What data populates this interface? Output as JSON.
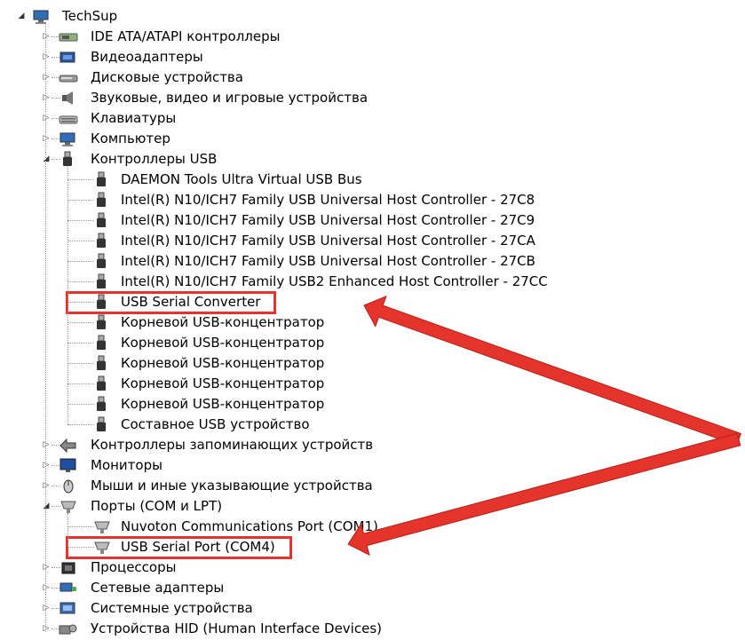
{
  "root": {
    "label": "TechSup",
    "icon": "computer-icon"
  },
  "categories": [
    {
      "label": "IDE ATA/ATAPI контроллеры",
      "icon": "ide-controller-icon",
      "expanded": false
    },
    {
      "label": "Видеоадаптеры",
      "icon": "display-adapter-icon",
      "expanded": false
    },
    {
      "label": "Дисковые устройства",
      "icon": "disk-drive-icon",
      "expanded": false
    },
    {
      "label": "Звуковые, видео и игровые устройства",
      "icon": "speaker-icon",
      "expanded": false
    },
    {
      "label": "Клавиатуры",
      "icon": "keyboard-icon",
      "expanded": false
    },
    {
      "label": "Компьютер",
      "icon": "computer-icon",
      "expanded": false
    },
    {
      "label": "Контроллеры USB",
      "icon": "usb-plug-icon",
      "expanded": true,
      "children": [
        {
          "label": "DAEMON Tools Ultra Virtual USB Bus",
          "icon": "usb-plug-icon"
        },
        {
          "label": "Intel(R) N10/ICH7 Family USB Universal Host Controller - 27C8",
          "icon": "usb-plug-icon"
        },
        {
          "label": "Intel(R) N10/ICH7 Family USB Universal Host Controller - 27C9",
          "icon": "usb-plug-icon"
        },
        {
          "label": "Intel(R) N10/ICH7 Family USB Universal Host Controller - 27CA",
          "icon": "usb-plug-icon"
        },
        {
          "label": "Intel(R) N10/ICH7 Family USB Universal Host Controller - 27CB",
          "icon": "usb-plug-icon"
        },
        {
          "label": "Intel(R) N10/ICH7 Family USB2 Enhanced Host Controller - 27CC",
          "icon": "usb-plug-icon"
        },
        {
          "label": "USB Serial Converter",
          "icon": "usb-plug-icon",
          "highlighted": true
        },
        {
          "label": "Корневой USB-концентратор",
          "icon": "usb-plug-icon"
        },
        {
          "label": "Корневой USB-концентратор",
          "icon": "usb-plug-icon"
        },
        {
          "label": "Корневой USB-концентратор",
          "icon": "usb-plug-icon"
        },
        {
          "label": "Корневой USB-концентратор",
          "icon": "usb-plug-icon"
        },
        {
          "label": "Корневой USB-концентратор",
          "icon": "usb-plug-icon"
        },
        {
          "label": "Составное USB устройство",
          "icon": "usb-plug-icon"
        }
      ]
    },
    {
      "label": "Контроллеры запоминающих устройств",
      "icon": "storage-controller-icon",
      "expanded": false
    },
    {
      "label": "Мониторы",
      "icon": "monitor-icon",
      "expanded": false
    },
    {
      "label": "Мыши и иные указывающие устройства",
      "icon": "mouse-icon",
      "expanded": false
    },
    {
      "label": "Порты (COM и LPT)",
      "icon": "port-icon",
      "expanded": true,
      "children": [
        {
          "label": "Nuvoton Communications Port (COM1)",
          "icon": "port-icon"
        },
        {
          "label": "USB Serial Port (COM4)",
          "icon": "port-icon",
          "highlighted": true
        }
      ]
    },
    {
      "label": "Процессоры",
      "icon": "processor-icon",
      "expanded": false
    },
    {
      "label": "Сетевые адаптеры",
      "icon": "network-adapter-icon",
      "expanded": false
    },
    {
      "label": "Системные устройства",
      "icon": "system-device-icon",
      "expanded": false
    },
    {
      "label": "Устройства HID (Human Interface Devices)",
      "icon": "hid-icon",
      "expanded": false
    }
  ],
  "annotation": {
    "color": "#e4342b"
  }
}
